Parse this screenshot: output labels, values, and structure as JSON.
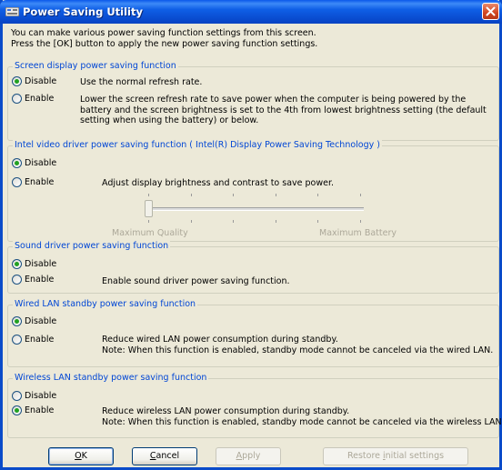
{
  "window": {
    "title": "Power Saving Utility"
  },
  "intro": {
    "line1": "You can make various power saving function settings from this screen.",
    "line2": "Press the [OK] button to apply the new power saving function settings."
  },
  "screen_display": {
    "legend": "Screen display power saving function",
    "disable_label": "Disable",
    "disable_desc": "Use the normal refresh rate.",
    "enable_label": "Enable",
    "enable_desc": [
      "Lower the screen refresh rate to save power when the computer is being powered by the",
      "battery and the screen brightness is set to the 4th from lowest brightness setting (the default",
      "setting when using the battery) or below."
    ],
    "selected": "Disable"
  },
  "intel_video": {
    "legend": "Intel video driver power saving function ( Intel(R) Display Power Saving Technology )",
    "disable_label": "Disable",
    "enable_label": "Enable",
    "enable_desc": "Adjust display brightness and contrast to save power.",
    "slider_min_label": "Maximum Quality",
    "slider_max_label": "Maximum Battery",
    "slider_level": 0,
    "slider_enabled": false,
    "selected": "Disable"
  },
  "sound_driver": {
    "legend": "Sound driver power saving function",
    "disable_label": "Disable",
    "enable_label": "Enable",
    "enable_desc": "Enable sound driver power saving function.",
    "selected": "Disable"
  },
  "wired_lan": {
    "legend": "Wired LAN standby power saving function",
    "disable_label": "Disable",
    "enable_label": "Enable",
    "enable_desc": [
      "Reduce wired LAN power consumption during standby.",
      "Note: When this function is enabled, standby mode cannot be canceled via the wired LAN."
    ],
    "selected": "Disable"
  },
  "wireless_lan": {
    "legend": "Wireless LAN standby power saving function",
    "disable_label": "Disable",
    "enable_label": "Enable",
    "enable_desc": [
      "Reduce wireless LAN power consumption during standby.",
      "Note: When this function is enabled, standby mode cannot be canceled via the wireless LAN."
    ],
    "selected": "Enable"
  },
  "buttons": {
    "ok_mn": "O",
    "ok_rest": "K",
    "cancel_mn": "C",
    "cancel_rest": "ancel",
    "apply_mn": "A",
    "apply_rest": "pply",
    "restore_before": "Restore ",
    "restore_mn": "i",
    "restore_after": "nitial settings"
  },
  "colors": {
    "title_bar": "#0A58EA",
    "legend_text": "#0046D5",
    "dialog_bg": "#ECE9D8",
    "radio_dot": "#21A121",
    "close_button": "#D14520"
  }
}
